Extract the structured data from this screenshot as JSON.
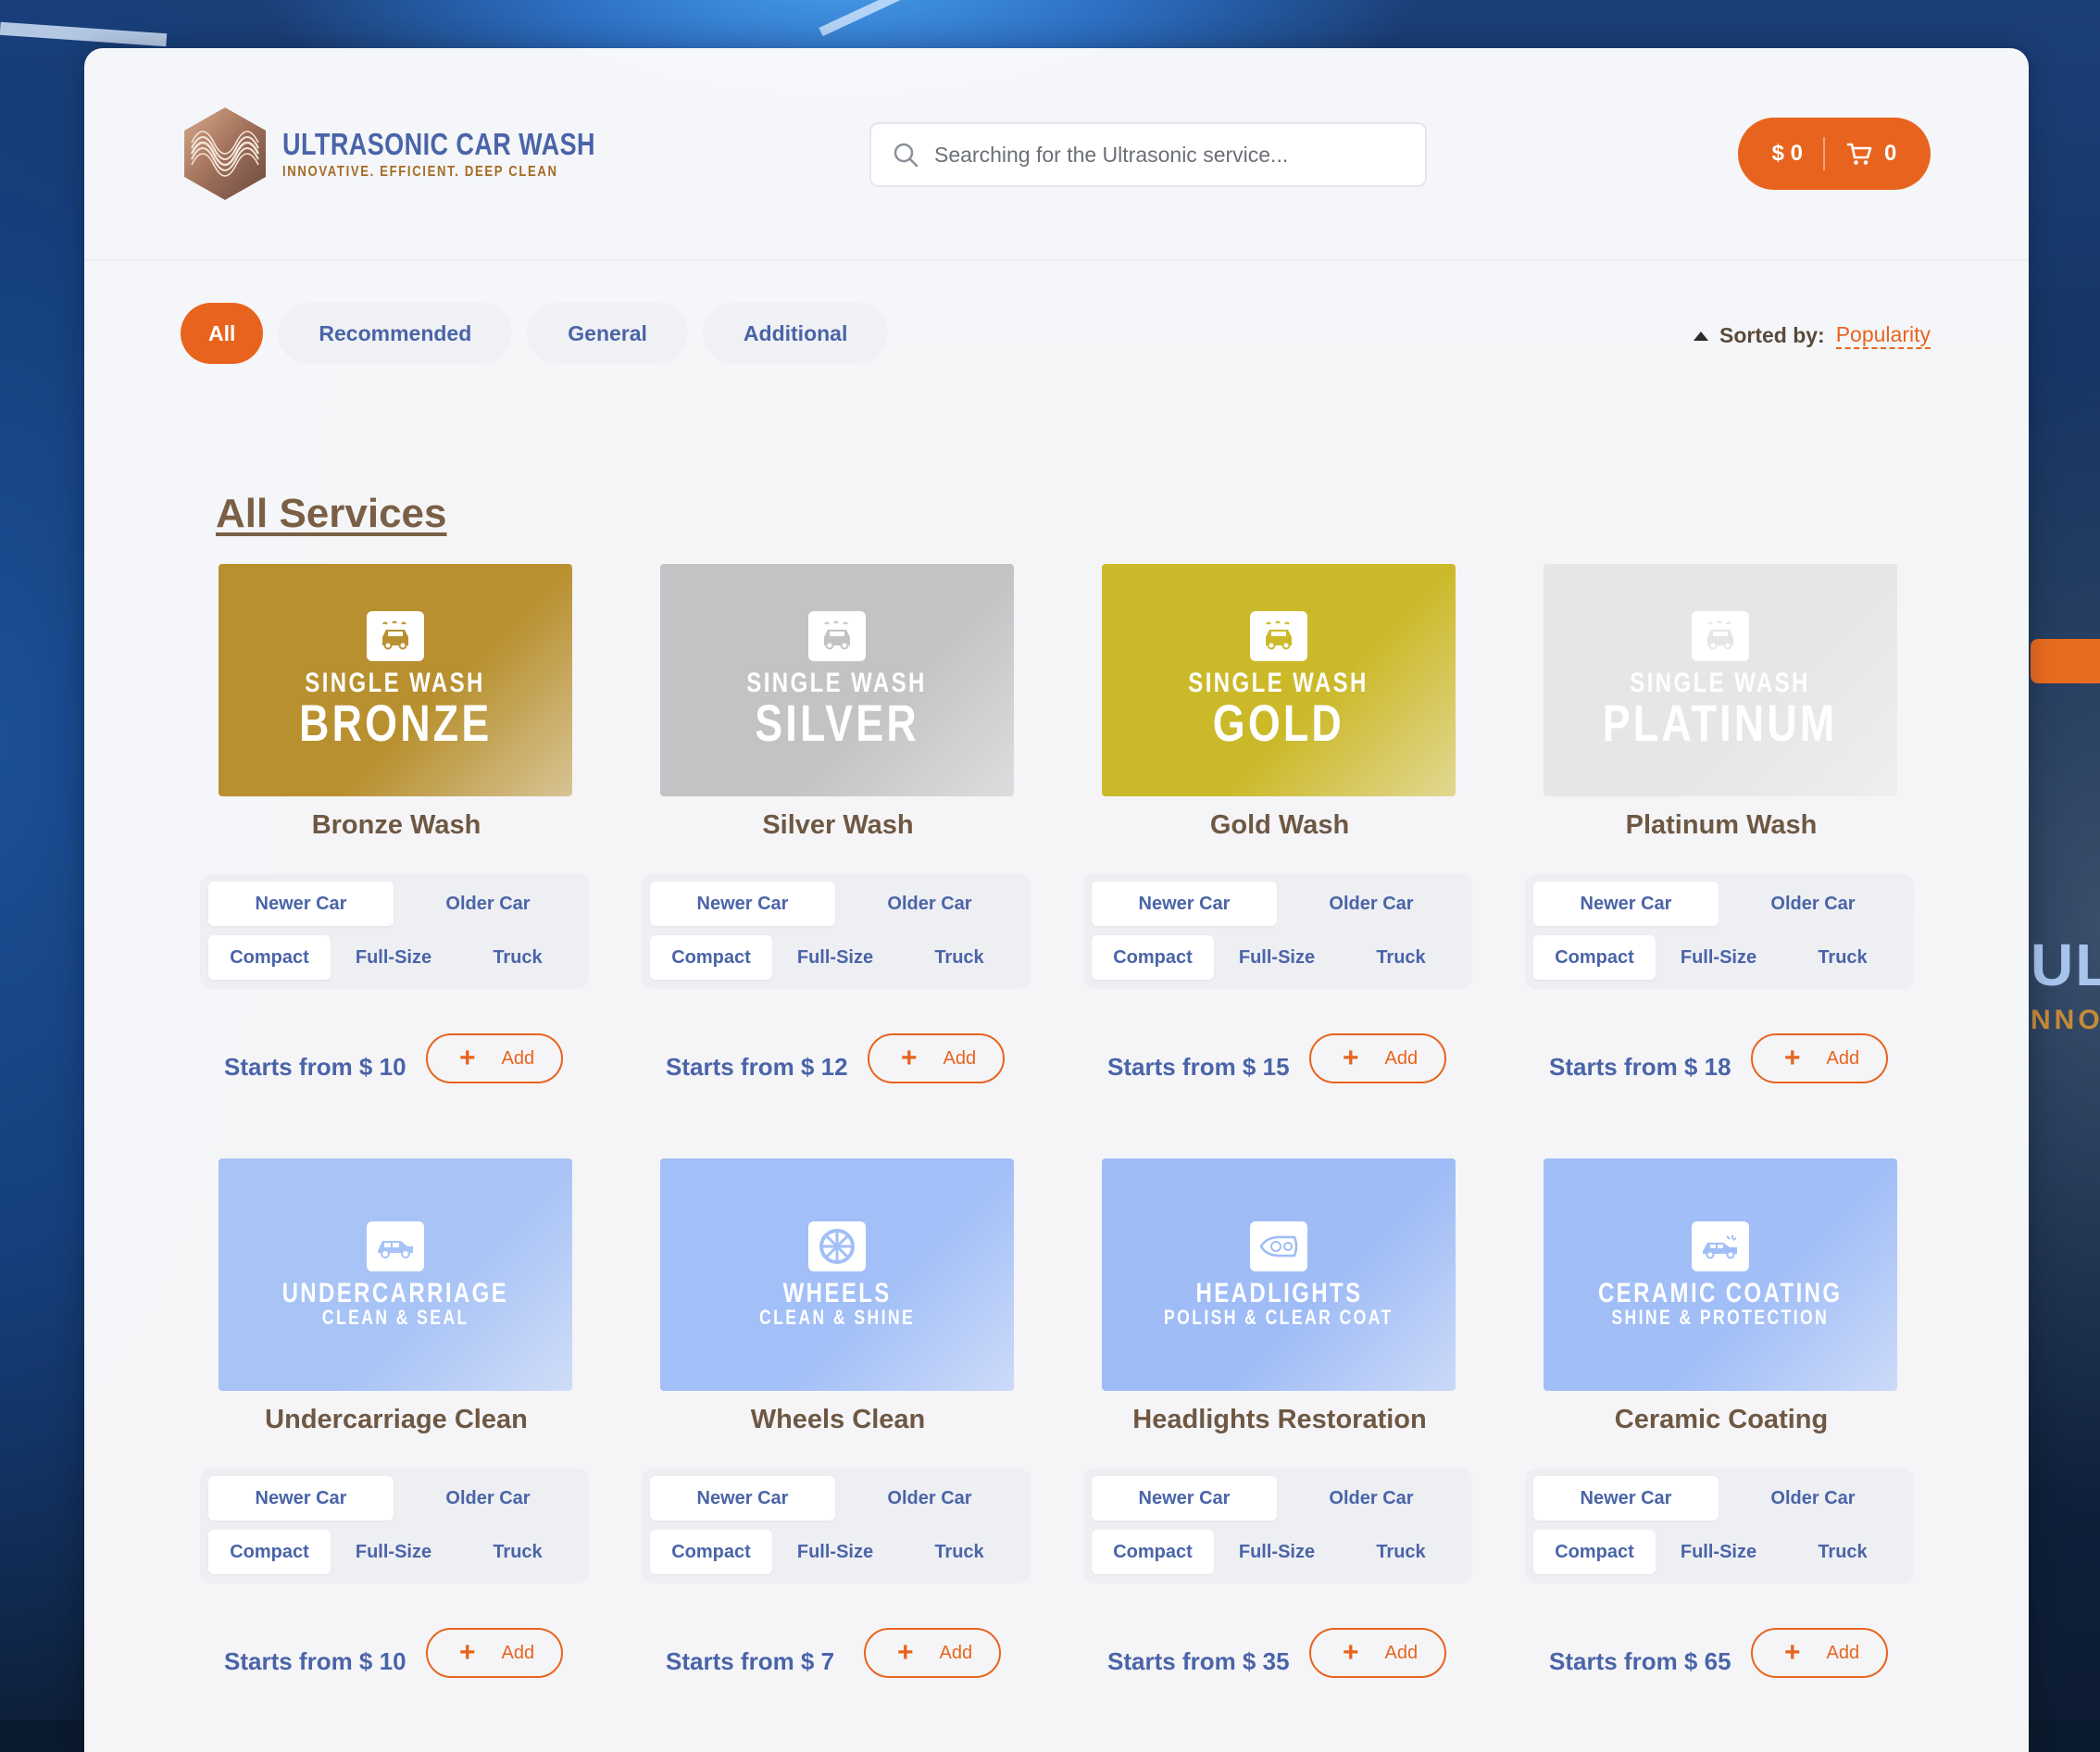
{
  "brand": {
    "title": "ULTRASONIC CAR WASH",
    "tagline": "INNOVATIVE. EFFICIENT. DEEP CLEAN"
  },
  "search": {
    "placeholder": "Searching for the Ultrasonic service..."
  },
  "cart": {
    "total": "$ 0",
    "count": "0"
  },
  "filters": [
    {
      "label": "All",
      "active": true
    },
    {
      "label": "Recommended",
      "active": false
    },
    {
      "label": "General",
      "active": false
    },
    {
      "label": "Additional",
      "active": false
    }
  ],
  "sort": {
    "label": "Sorted by:",
    "value": "Popularity"
  },
  "section_title": "All Services",
  "options": {
    "age": [
      "Newer Car",
      "Older Car"
    ],
    "size": [
      "Compact",
      "Full-Size",
      "Truck"
    ],
    "selected_age": "Newer Car",
    "selected_size": "Compact"
  },
  "add_label": "Add",
  "services": [
    {
      "name": "Bronze Wash",
      "price": "Starts from $ 10",
      "img_line1": "SINGLE WASH",
      "img_line2": "BRONZE",
      "icon": "car-wash-icon",
      "color": "#b8902f"
    },
    {
      "name": "Silver Wash",
      "price": "Starts from $ 12",
      "img_line1": "SINGLE WASH",
      "img_line2": "SILVER",
      "icon": "car-wash-icon",
      "color": "#c3c3c5"
    },
    {
      "name": "Gold Wash",
      "price": "Starts from $ 15",
      "img_line1": "SINGLE WASH",
      "img_line2": "GOLD",
      "icon": "car-wash-icon",
      "color": "#ccb92a"
    },
    {
      "name": "Platinum Wash",
      "price": "Starts from $ 18",
      "img_line1": "SINGLE WASH",
      "img_line2": "PLATINUM",
      "icon": "car-wash-icon",
      "color": "#e6e6e7"
    },
    {
      "name": "Undercarriage Clean",
      "price": "Starts from $ 10",
      "img_line1": "UNDERCARRIAGE",
      "img_line2": "CLEAN & SEAL",
      "icon": "car-side-icon",
      "color": "#a8c3f6"
    },
    {
      "name": "Wheels Clean",
      "price": "Starts from $ 7",
      "img_line1": "WHEELS",
      "img_line2": "CLEAN & SHINE",
      "icon": "wheel-icon",
      "color": "#a2bff7"
    },
    {
      "name": "Headlights Restoration",
      "price": "Starts from $ 35",
      "img_line1": "HEADLIGHTS",
      "img_line2": "POLISH & CLEAR COAT",
      "icon": "headlight-icon",
      "color": "#9fbcf6"
    },
    {
      "name": "Ceramic Coating",
      "price": "Starts from $ 65",
      "img_line1": "CERAMIC COATING",
      "img_line2": "SHINE & PROTECTION",
      "icon": "car-spray-icon",
      "color": "#a1bef7"
    }
  ]
}
